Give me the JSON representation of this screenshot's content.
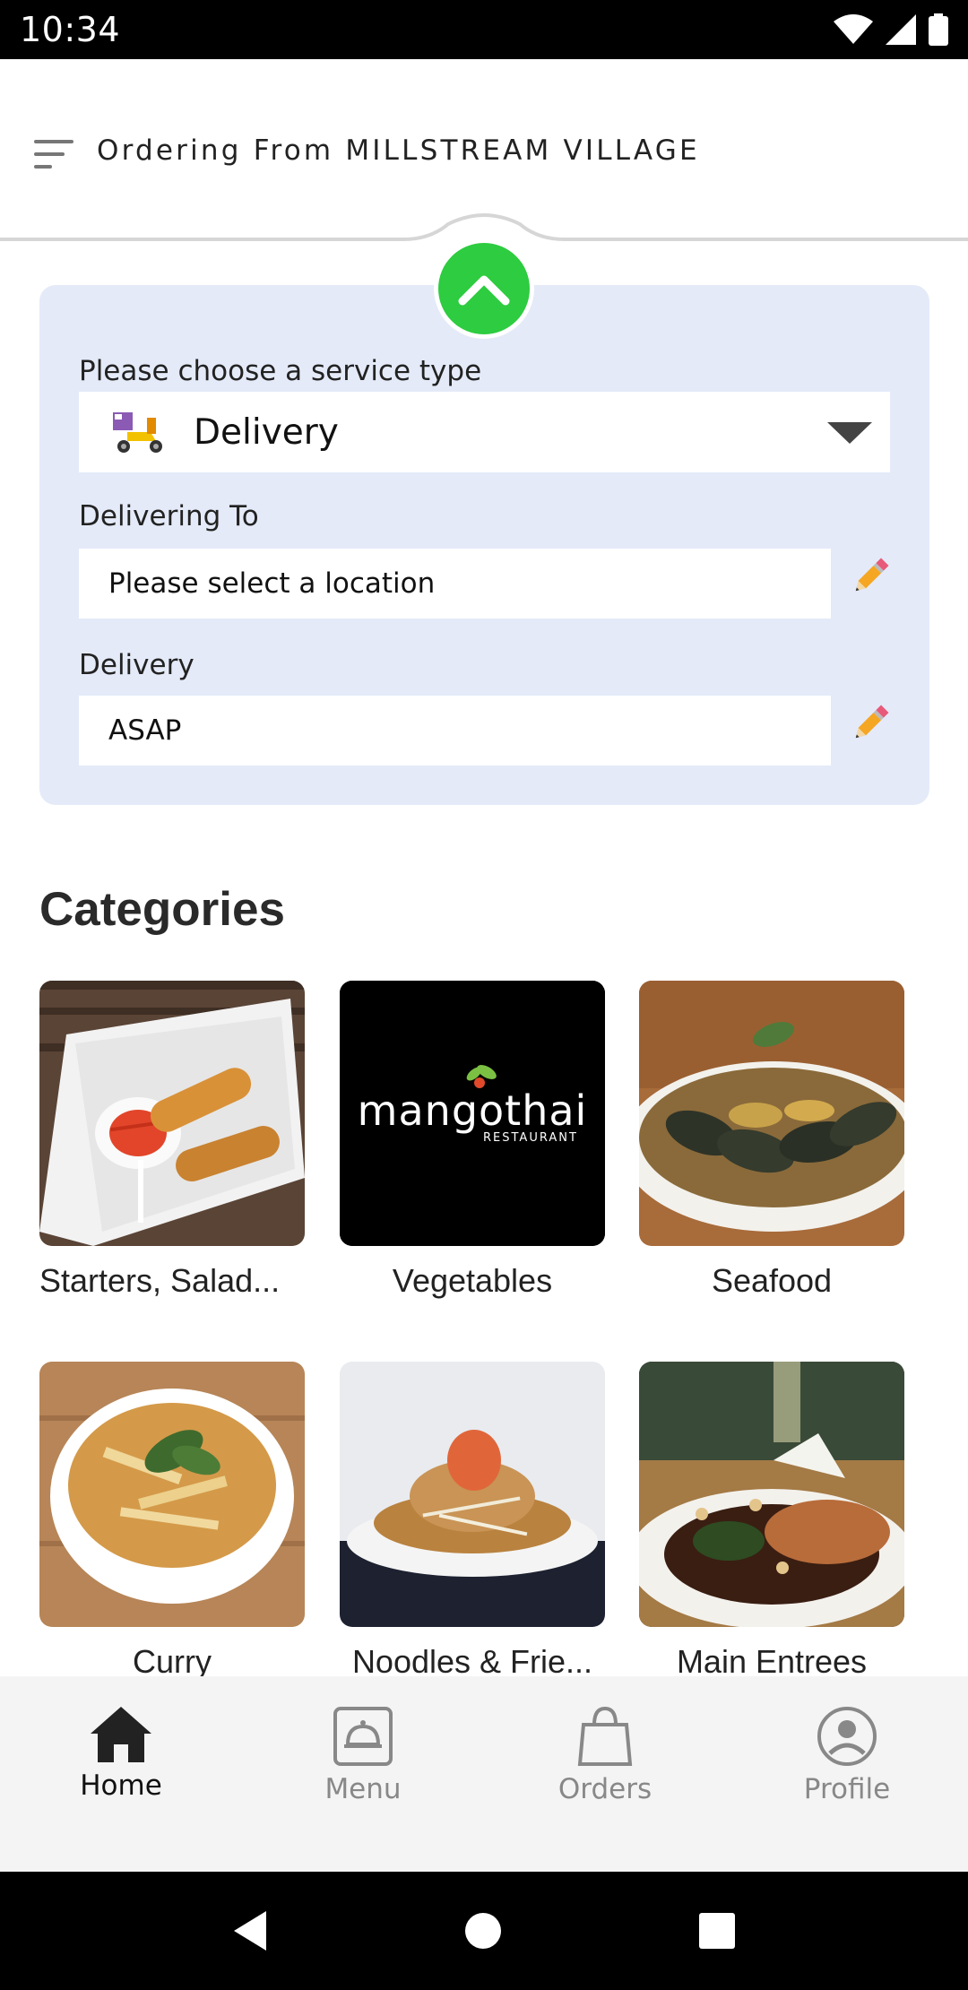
{
  "status_bar": {
    "time": "10:34"
  },
  "header": {
    "title": "Ordering From MILLSTREAM VILLAGE"
  },
  "service_panel": {
    "service_type_label": "Please choose a service type",
    "service_type_value": "Delivery",
    "delivering_to_label": "Delivering To",
    "location_value": "Please select a location",
    "delivery_time_label": "Delivery",
    "delivery_time_value": "ASAP"
  },
  "categories": {
    "title": "Categories",
    "items": [
      {
        "label": "Starters, Salad..."
      },
      {
        "label": "Vegetables",
        "logo_text": "mangothai",
        "logo_subtext": "RESTAURANT"
      },
      {
        "label": "Seafood"
      },
      {
        "label": "Curry"
      },
      {
        "label": "Noodles & Frie..."
      },
      {
        "label": "Main Entrees"
      }
    ]
  },
  "bottom_nav": {
    "items": [
      {
        "label": "Home",
        "icon": "home-icon",
        "active": true
      },
      {
        "label": "Menu",
        "icon": "menu-cloche-icon",
        "active": false
      },
      {
        "label": "Orders",
        "icon": "shopping-bag-icon",
        "active": false
      },
      {
        "label": "Profile",
        "icon": "profile-icon",
        "active": false
      }
    ]
  },
  "colors": {
    "accent_green": "#2ecc40",
    "panel_bg": "#e4eaf8",
    "nav_bg": "#f4f4f4"
  }
}
